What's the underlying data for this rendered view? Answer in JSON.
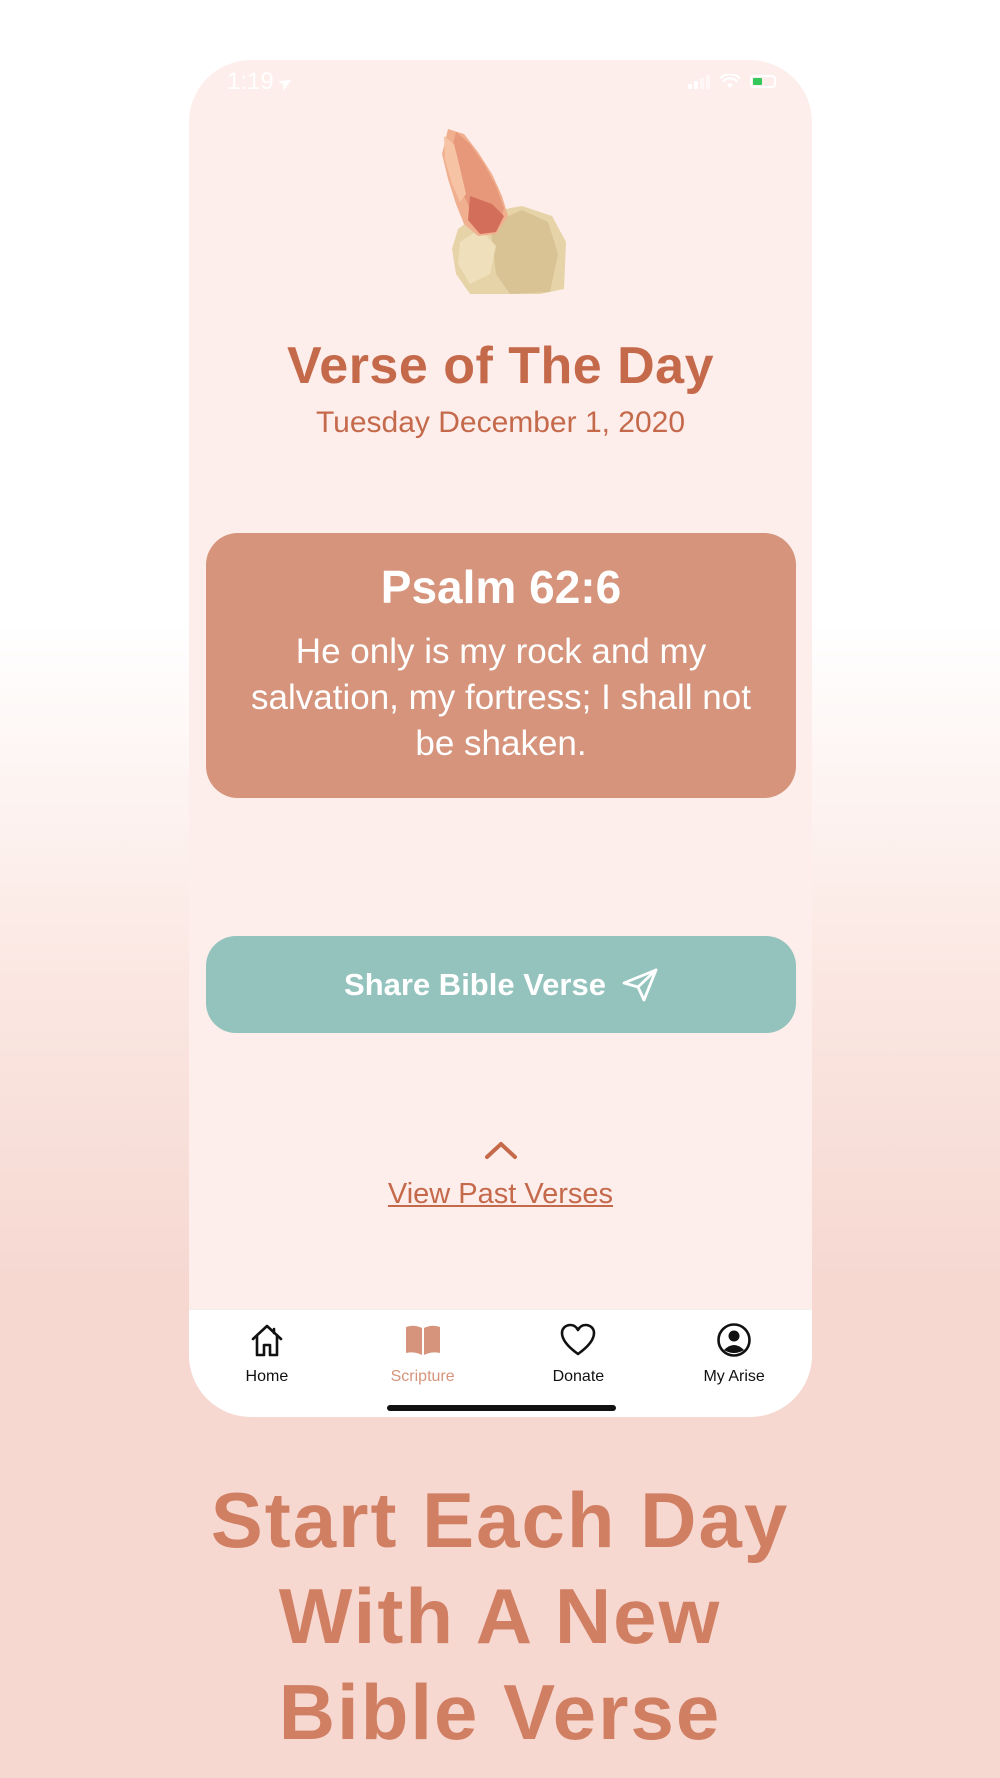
{
  "status_bar": {
    "time": "1:19"
  },
  "header": {
    "title": "Verse of The Day",
    "date": "Tuesday December 1, 2020"
  },
  "verse": {
    "reference": "Psalm 62:6",
    "text": "He only is my rock and my salvation, my fortress; I shall not be shaken."
  },
  "share": {
    "label": "Share Bible Verse",
    "icon": "send-icon"
  },
  "past_verses": {
    "label": "View Past Verses",
    "icon": "chevron-up-icon"
  },
  "tab_bar": {
    "tabs": [
      {
        "label": "Home",
        "icon": "home-icon",
        "active": false
      },
      {
        "label": "Scripture",
        "icon": "book-icon",
        "active": true
      },
      {
        "label": "Donate",
        "icon": "heart-icon",
        "active": false
      },
      {
        "label": "My Arise",
        "icon": "profile-icon",
        "active": false
      }
    ]
  },
  "caption": {
    "lines": [
      "Start Each Day",
      "With A New",
      "Bible Verse"
    ]
  },
  "colors": {
    "accent": "#c5694b",
    "card": "#d5947b",
    "share_button": "#94c3bd",
    "background": "#fdeeec",
    "caption": "#d17f63"
  }
}
